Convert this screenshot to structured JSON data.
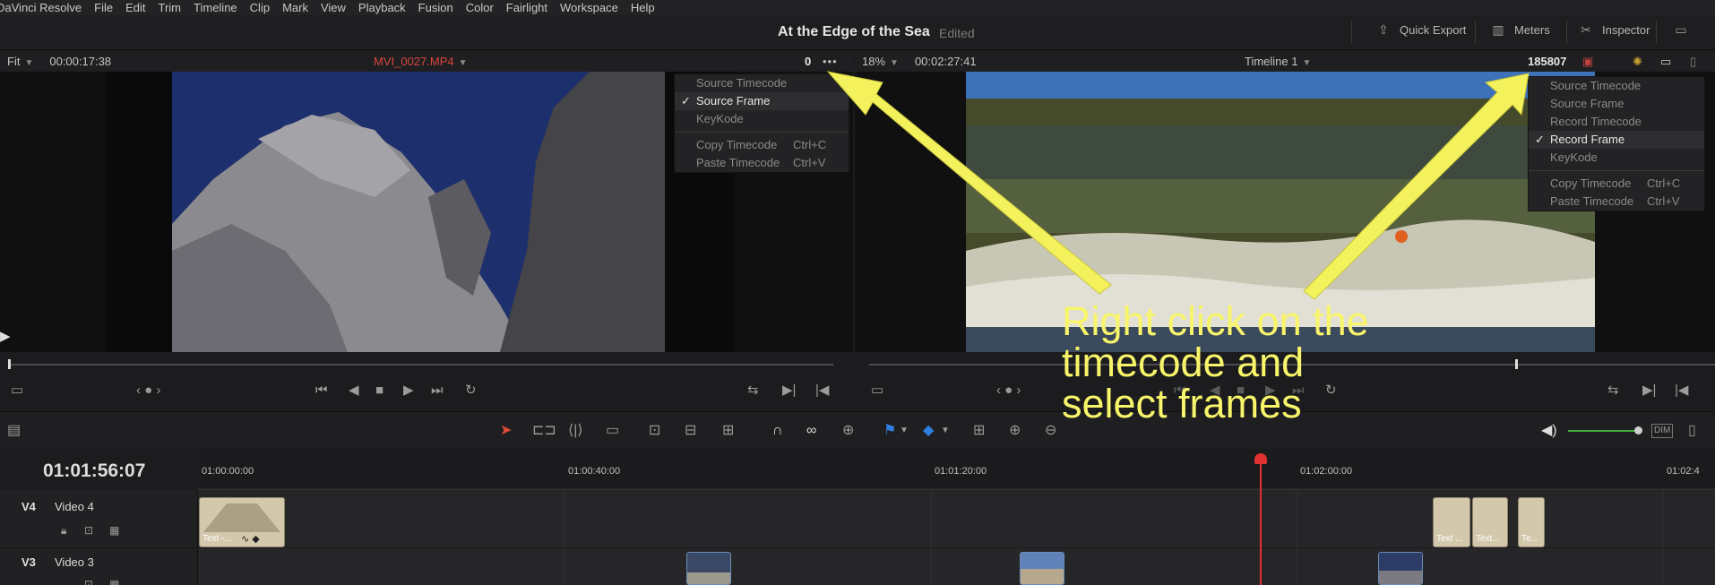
{
  "menu": [
    "DaVinci Resolve",
    "File",
    "Edit",
    "Trim",
    "Timeline",
    "Clip",
    "Mark",
    "View",
    "Playback",
    "Fusion",
    "Color",
    "Fairlight",
    "Workspace",
    "Help"
  ],
  "title": {
    "project": "At the Edge of the Sea",
    "status": "Edited"
  },
  "titlebar_buttons": [
    {
      "label": "Quick Export",
      "icon": "export-icon"
    },
    {
      "label": "Meters",
      "icon": "meters-icon"
    },
    {
      "label": "Inspector",
      "icon": "inspector-icon"
    }
  ],
  "source_viewer": {
    "zoom": "Fit",
    "timecode": "00:00:17:38",
    "clip_name": "MVI_0027.MP4",
    "frame_readout": "0",
    "context_menu": {
      "items": [
        {
          "label": "Source Timecode",
          "checked": false
        },
        {
          "label": "Source Frame",
          "checked": true
        },
        {
          "label": "KeyKode",
          "checked": false
        }
      ],
      "actions": [
        {
          "label": "Copy Timecode",
          "shortcut": "Ctrl+C"
        },
        {
          "label": "Paste Timecode",
          "shortcut": "Ctrl+V"
        }
      ]
    }
  },
  "timeline_viewer": {
    "zoom": "18%",
    "timecode": "00:02:27:41",
    "timeline_name": "Timeline 1",
    "frame_readout": "185807",
    "context_menu": {
      "items": [
        {
          "label": "Source Timecode",
          "checked": false
        },
        {
          "label": "Source Frame",
          "checked": false
        },
        {
          "label": "Record Timecode",
          "checked": false
        },
        {
          "label": "Record Frame",
          "checked": true
        },
        {
          "label": "KeyKode",
          "checked": false
        }
      ],
      "actions": [
        {
          "label": "Copy Timecode",
          "shortcut": "Ctrl+C"
        },
        {
          "label": "Paste Timecode",
          "shortcut": "Ctrl+V"
        }
      ]
    }
  },
  "check_mark": "✓",
  "timeline": {
    "current_timecode": "01:01:56:07",
    "ruler_labels": [
      "01:00:00:00",
      "01:00:40:00",
      "01:01:20:00",
      "01:02:00:00",
      "01:02:4"
    ],
    "tracks": [
      {
        "id": "V4",
        "name": "Video 4"
      },
      {
        "id": "V3",
        "name": "Video 3"
      }
    ],
    "v4_clips": [
      "Text -...",
      "Text ...",
      "Text...",
      "Te..."
    ]
  },
  "annotation": {
    "text": "Right click on the\ntimecode and\nselect frames",
    "color": "#f8f56a"
  },
  "colors": {
    "clip_name": "#d9463e",
    "playhead": "#e03030",
    "title_clip": "#d4c8ac",
    "flag_blue": "#2f7fe0"
  }
}
